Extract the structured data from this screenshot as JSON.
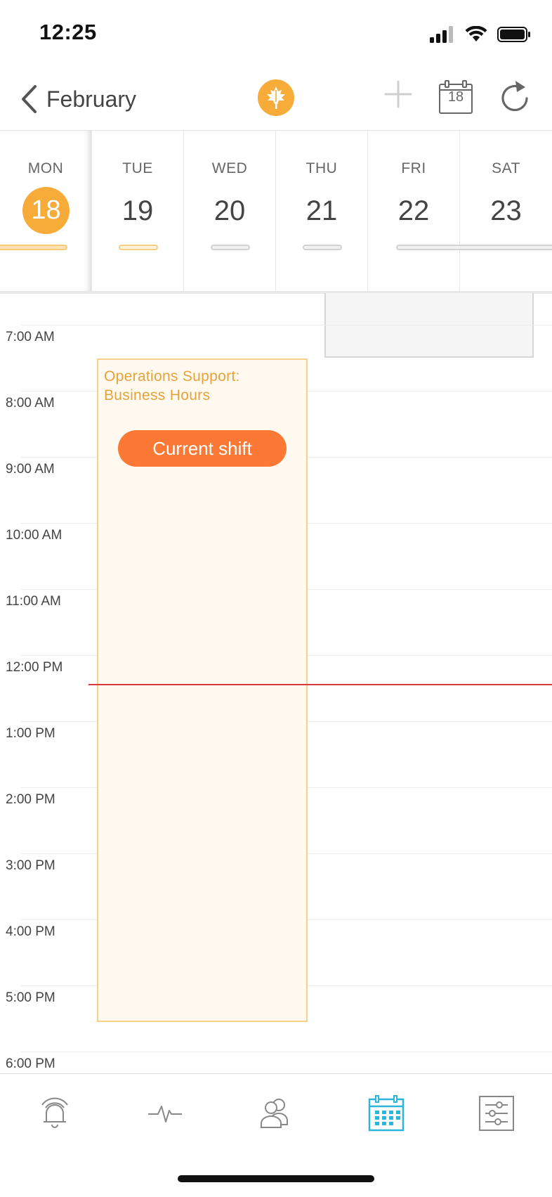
{
  "status_bar": {
    "time": "12:25"
  },
  "nav": {
    "back_label": "February",
    "calendar_day": "18"
  },
  "days": [
    {
      "name": "MON",
      "num": "18",
      "today": true
    },
    {
      "name": "TUE",
      "num": "19"
    },
    {
      "name": "WED",
      "num": "20"
    },
    {
      "name": "THU",
      "num": "21"
    },
    {
      "name": "FRI",
      "num": "22"
    },
    {
      "name": "SAT",
      "num": "23"
    }
  ],
  "hours": [
    "7:00 AM",
    "8:00 AM",
    "9:00 AM",
    "10:00 AM",
    "11:00 AM",
    "12:00 PM",
    "1:00 PM",
    "2:00 PM",
    "3:00 PM",
    "4:00 PM",
    "5:00 PM",
    "6:00 PM"
  ],
  "shift": {
    "title": "Operations Support: Business Hours",
    "pill": "Current shift"
  },
  "tabs": [
    "alerts-icon",
    "activity-icon",
    "people-icon",
    "calendar-icon",
    "settings-icon"
  ],
  "colors": {
    "accent": "#f7ac39",
    "active_tab": "#29b6d8",
    "shift_pill": "#fb7935",
    "now_line": "#d8383c"
  }
}
